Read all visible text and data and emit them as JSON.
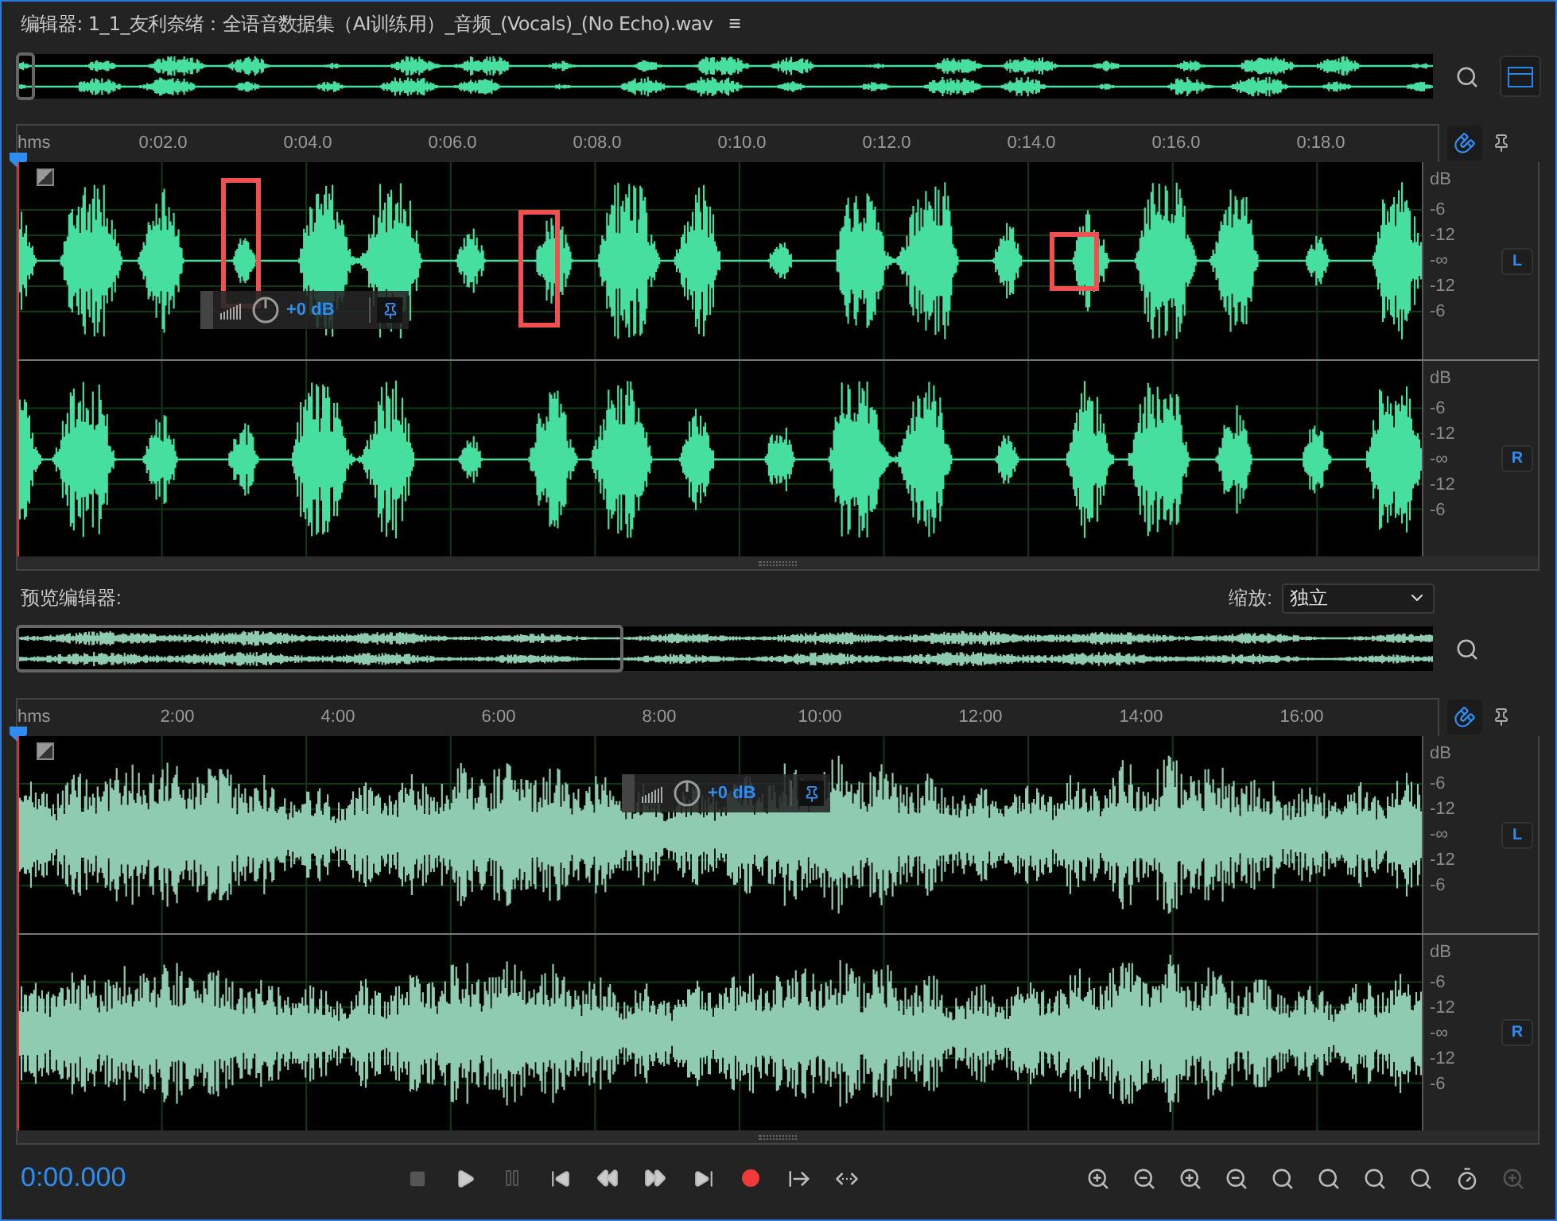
{
  "editor": {
    "title": "编辑器: 1_1_友利奈绪：全语音数据集（AI训练用）_音频_(Vocals)_(No Echo).wav",
    "menu_glyph": "≡"
  },
  "main_view": {
    "kind": "speech",
    "ruler": {
      "unit": "hms",
      "ticks": [
        "0:02.0",
        "0:04.0",
        "0:06.0",
        "0:08.0",
        "0:10.0",
        "0:12.0",
        "0:14.0",
        "0:16.0",
        "0:18.0"
      ]
    },
    "channels": [
      {
        "label": "L",
        "scale": [
          "dB",
          "-6",
          "-12",
          "-∞",
          "-12",
          "-6"
        ]
      },
      {
        "label": "R",
        "scale": [
          "dB",
          "-6",
          "-12",
          "-∞",
          "-12",
          "-6"
        ]
      }
    ],
    "hud": {
      "reading": "+0 dB"
    }
  },
  "preview": {
    "label": "预览编辑器:",
    "zoom_label": "缩放:",
    "zoom_value": "独立"
  },
  "preview_view": {
    "kind": "dense",
    "ruler": {
      "unit": "hms",
      "ticks": [
        "2:00",
        "4:00",
        "6:00",
        "8:00",
        "10:00",
        "12:00",
        "14:00",
        "16:00"
      ]
    },
    "channels": [
      {
        "label": "L",
        "scale": [
          "dB",
          "-6",
          "-12",
          "-∞",
          "-12",
          "-6"
        ]
      },
      {
        "label": "R",
        "scale": [
          "dB",
          "-6",
          "-12",
          "-∞",
          "-12",
          "-6"
        ]
      }
    ],
    "hud": {
      "reading": "+0 dB"
    }
  },
  "transport": {
    "time": "0:00.000"
  }
}
